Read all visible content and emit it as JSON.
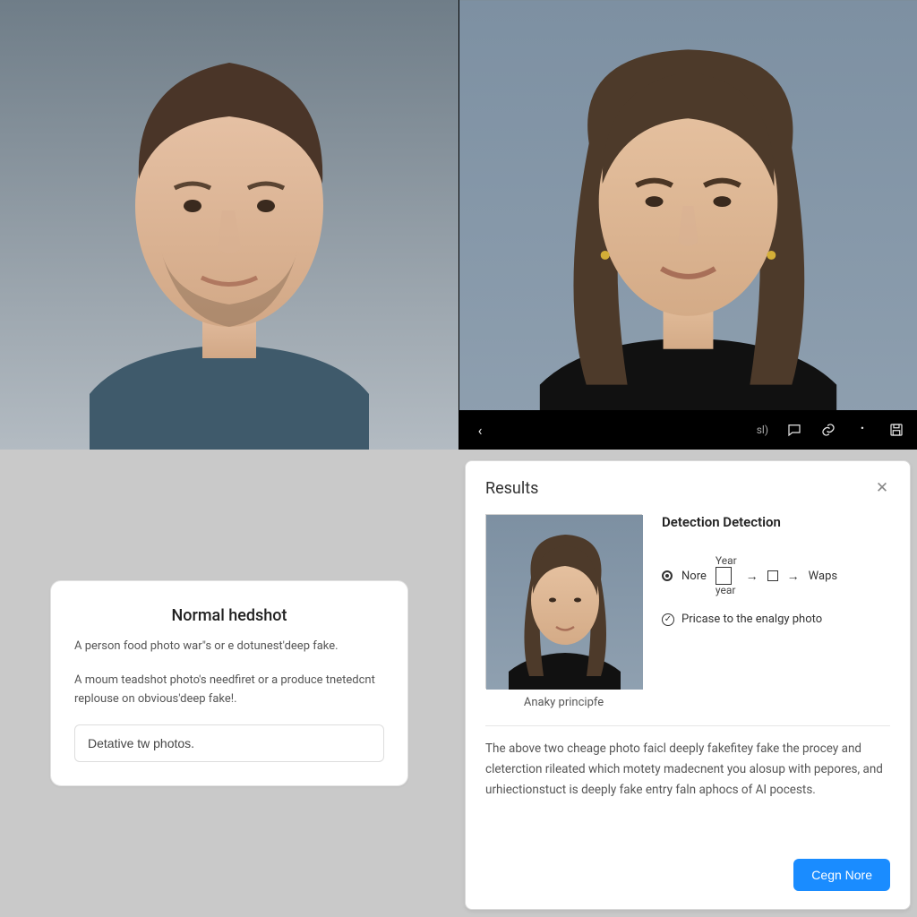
{
  "photos": {
    "left_alt": "male-headshot",
    "right_alt": "female-headshot"
  },
  "toolbar": {
    "label": "sl)",
    "icons": {
      "back": "back-icon",
      "comment": "comment-icon",
      "link": "link-icon",
      "more": "more-icon",
      "save": "save-icon"
    }
  },
  "left_card": {
    "title": "Normal hedshot",
    "line1": "A person food photo war\"s or e dotunest'deep fake.",
    "line2": "A moum teadshot photo's needfiret or a produce tnetedcnt replouse on obvious'deep fake!.",
    "input_value": "Detative tw photos."
  },
  "results": {
    "title": "Results",
    "thumb_caption": "Anaky principfe",
    "detection_title": "Detection Detection",
    "pipeline": {
      "radio_label": "Nore",
      "year_top": "Year",
      "year_bottom": "year",
      "end_label": "Waps"
    },
    "check_label": "Pricase to the enalgy photo",
    "paragraph": "The above two cheage photo faicl deeply fakefitey fake the procey and cleterction rileated which motety madecnent you alosup with pepores, and urhiectionstuct is deeply fake entry faln aphocs of AI pocests.",
    "button": "Cegn Nore"
  }
}
